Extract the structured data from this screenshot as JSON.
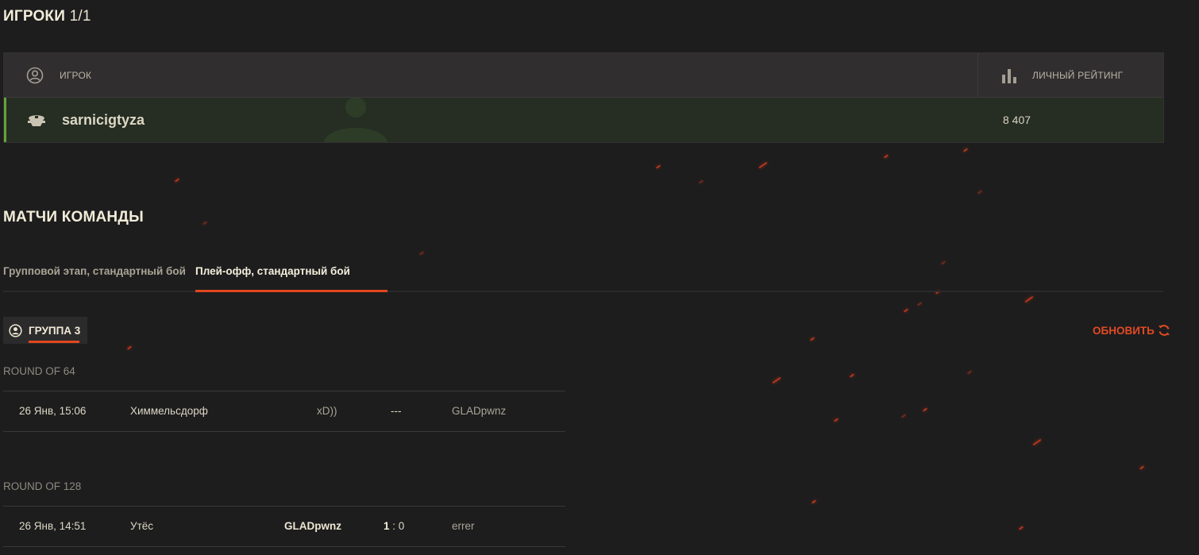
{
  "players_section": {
    "title": "ИГРОКИ",
    "count": "1/1",
    "columns": {
      "player": "ИГРОК",
      "rating": "ЛИЧНЫЙ РЕЙТИНГ"
    },
    "rows": [
      {
        "name": "sarnicigtyza",
        "rating": "8 407"
      }
    ]
  },
  "matches_section": {
    "title": "МАТЧИ КОМАНДЫ",
    "tabs": [
      {
        "label": "Групповой этап, стандартный бой",
        "active": false
      },
      {
        "label": "Плей-офф, стандартный бой",
        "active": true
      }
    ],
    "group": "ГРУППА 3",
    "refresh_label": "ОБНОВИТЬ",
    "rounds": [
      {
        "label": "ROUND OF 64",
        "matches": [
          {
            "date": "26 Янв, 15:06",
            "map": "Химмельсдорф",
            "team1": "xD))",
            "score": "---",
            "team2": "GLADpwnz",
            "winner": "none"
          }
        ]
      },
      {
        "label": "ROUND OF 128",
        "matches": [
          {
            "date": "26 Янв, 14:51",
            "map": "Утёс",
            "team1": "GLADpwnz",
            "score_left": "1",
            "score_sep": " : ",
            "score_right": "0",
            "team2": "errer",
            "winner": "team1"
          }
        ]
      }
    ]
  },
  "colors": {
    "background": "#1d1d1e",
    "accent": "#e2471e",
    "player_row": "#262d23",
    "player_row_border": "#62a53b"
  }
}
